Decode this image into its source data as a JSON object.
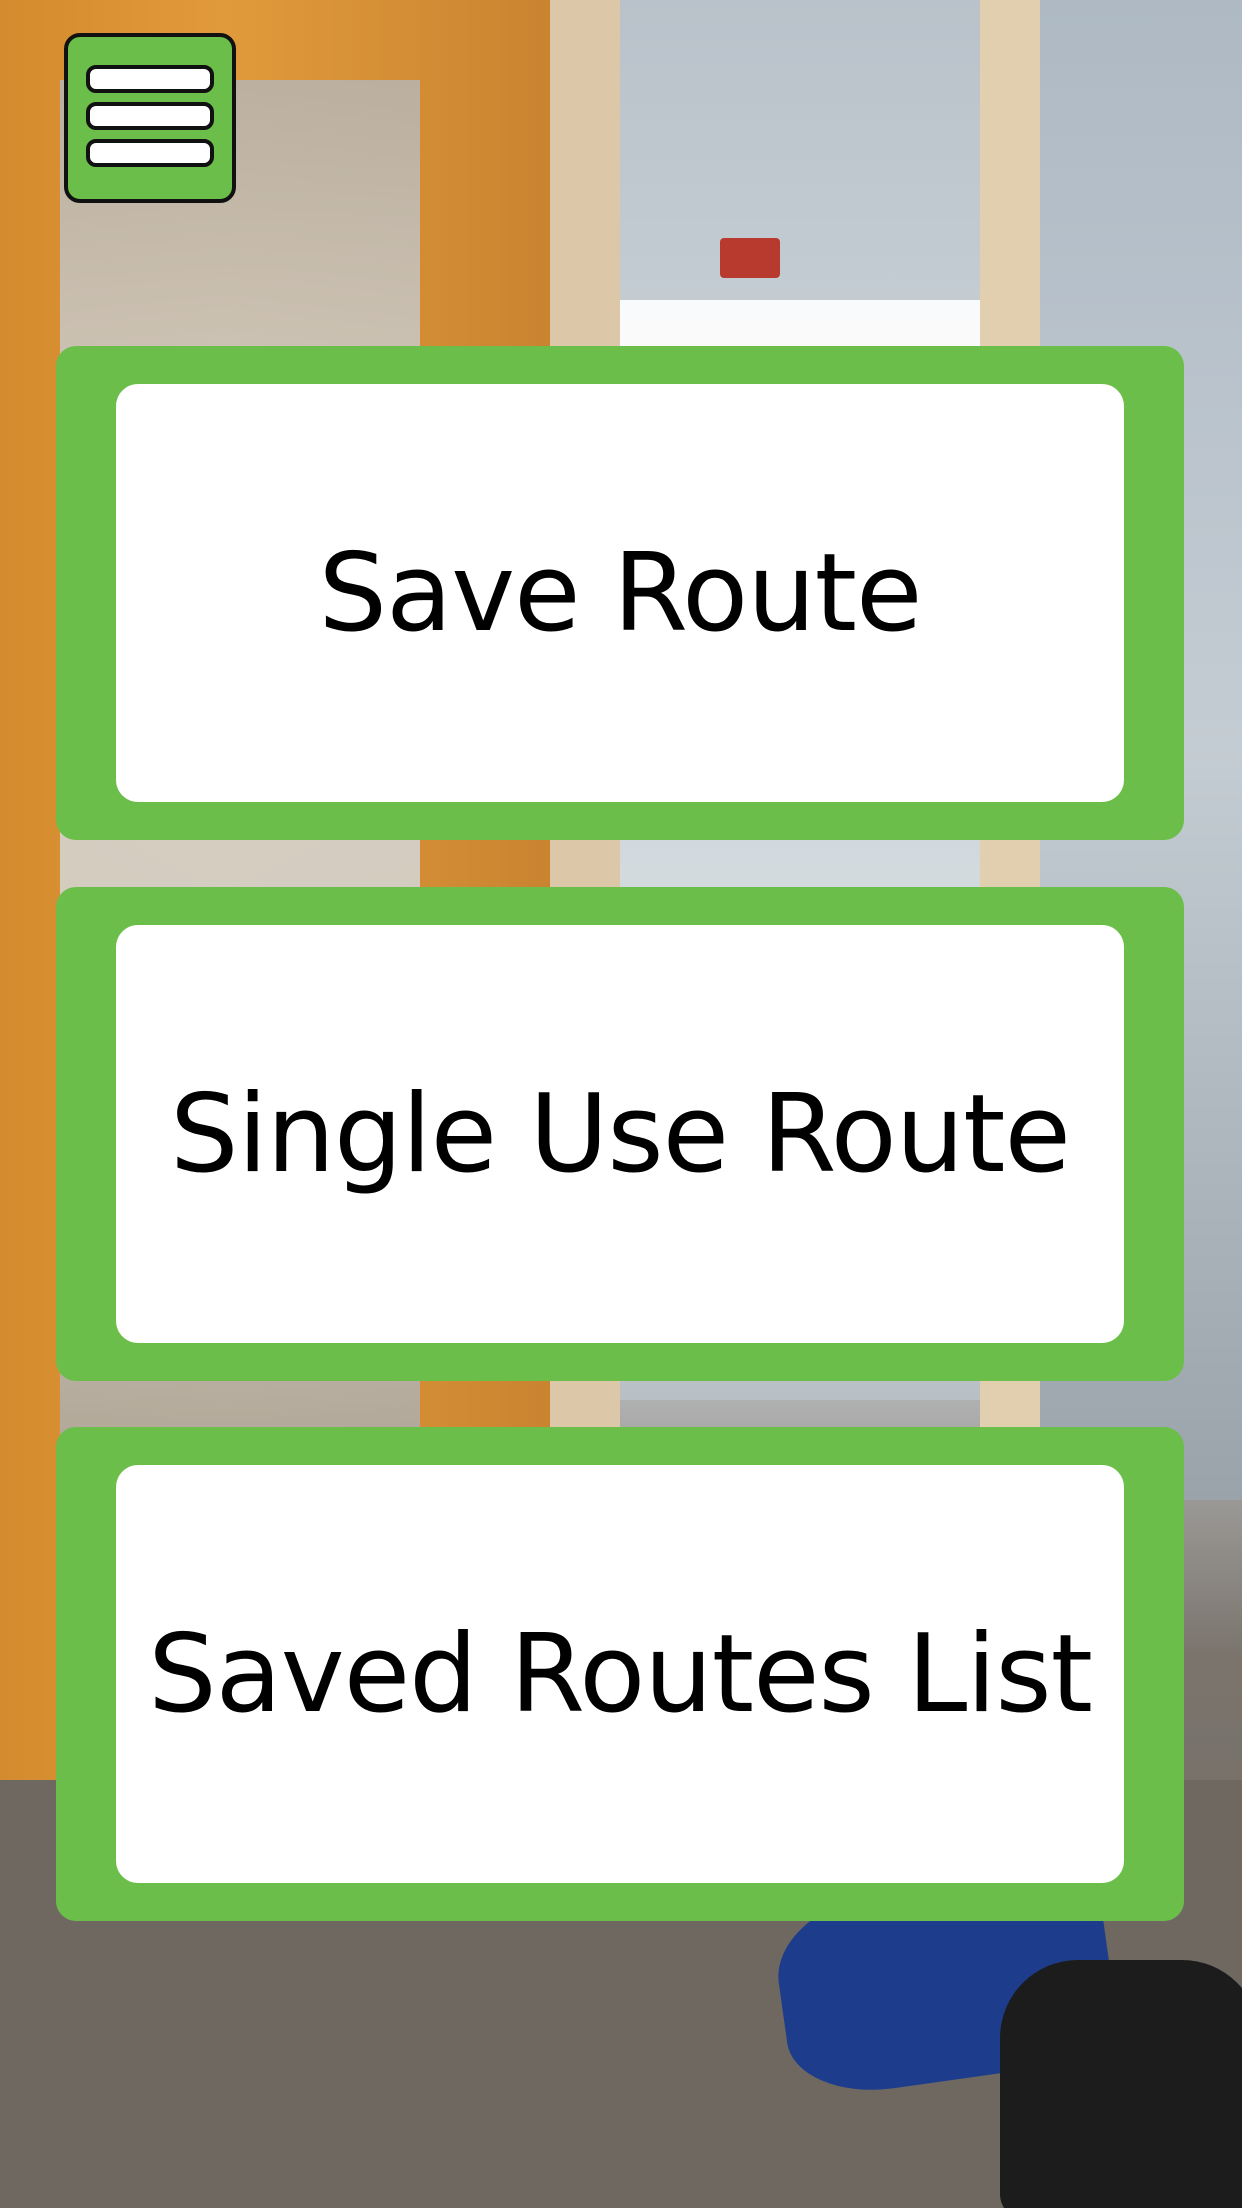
{
  "menu": {
    "icon": "hamburger-menu-icon",
    "accent_color": "#6cbe4a"
  },
  "actions": [
    {
      "label": "Save Route"
    },
    {
      "label": "Single Use Route"
    },
    {
      "label": "Saved Routes List"
    }
  ],
  "colors": {
    "button_frame": "#6cbe4a",
    "button_fill": "#ffffff",
    "button_text": "#000000"
  }
}
